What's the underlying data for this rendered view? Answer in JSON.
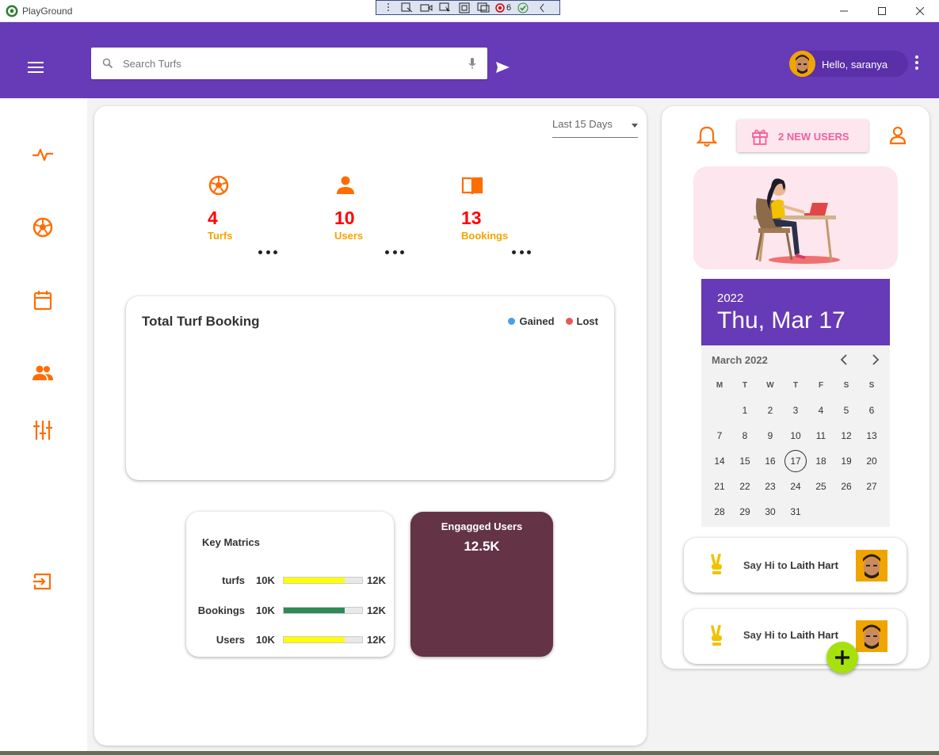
{
  "window": {
    "title": "PlayGround",
    "debug_count": "6"
  },
  "header": {
    "search_placeholder": "Search Turfs",
    "user_greeting": "Hello, saranya"
  },
  "main": {
    "date_range": "Last 15 Days",
    "stats": [
      {
        "value": "4",
        "label": "Turfs",
        "icon": "soccer-ball-icon"
      },
      {
        "value": "10",
        "label": "Users",
        "icon": "person-icon"
      },
      {
        "value": "13",
        "label": "Bookings",
        "icon": "book-icon"
      }
    ],
    "chart": {
      "title": "Total Turf Booking",
      "legend": [
        {
          "name": "Gained",
          "color": "#4a9fe8"
        },
        {
          "name": "Lost",
          "color": "#e85a5a"
        }
      ]
    },
    "metrics": {
      "title": "Key Matrics",
      "rows": [
        {
          "name": "turfs",
          "min": "10K",
          "max": "12K",
          "fill_fraction": 0.78,
          "color": "#ffff00"
        },
        {
          "name": "Bookings",
          "min": "10K",
          "max": "12K",
          "fill_fraction": 0.78,
          "color": "#2e8b57"
        },
        {
          "name": "Users",
          "min": "10K",
          "max": "12K",
          "fill_fraction": 0.78,
          "color": "#ffff00"
        }
      ]
    },
    "engaged": {
      "title": "Engagged Users",
      "value": "12.5K"
    }
  },
  "side": {
    "new_users_label": "2 NEW USERS",
    "calendar": {
      "year": "2022",
      "selected_date": "Thu, Mar 17",
      "month_label": "March 2022",
      "weekdays": [
        "M",
        "T",
        "W",
        "T",
        "F",
        "S",
        "S"
      ],
      "first_weekday_index": 1,
      "days_in_month": 31,
      "today": 17
    },
    "greetings": [
      {
        "prefix": "Say Hi to",
        "name": "Laith Hart"
      },
      {
        "prefix": "Say Hi to",
        "name": "Laith Hart"
      }
    ]
  },
  "colors": {
    "brand": "#673ab7",
    "accent_orange": "#ff6d00",
    "value_red": "#ff0000",
    "label_amber": "#f7a200",
    "engaged_bg": "#643346",
    "fab": "#a6e10f"
  }
}
